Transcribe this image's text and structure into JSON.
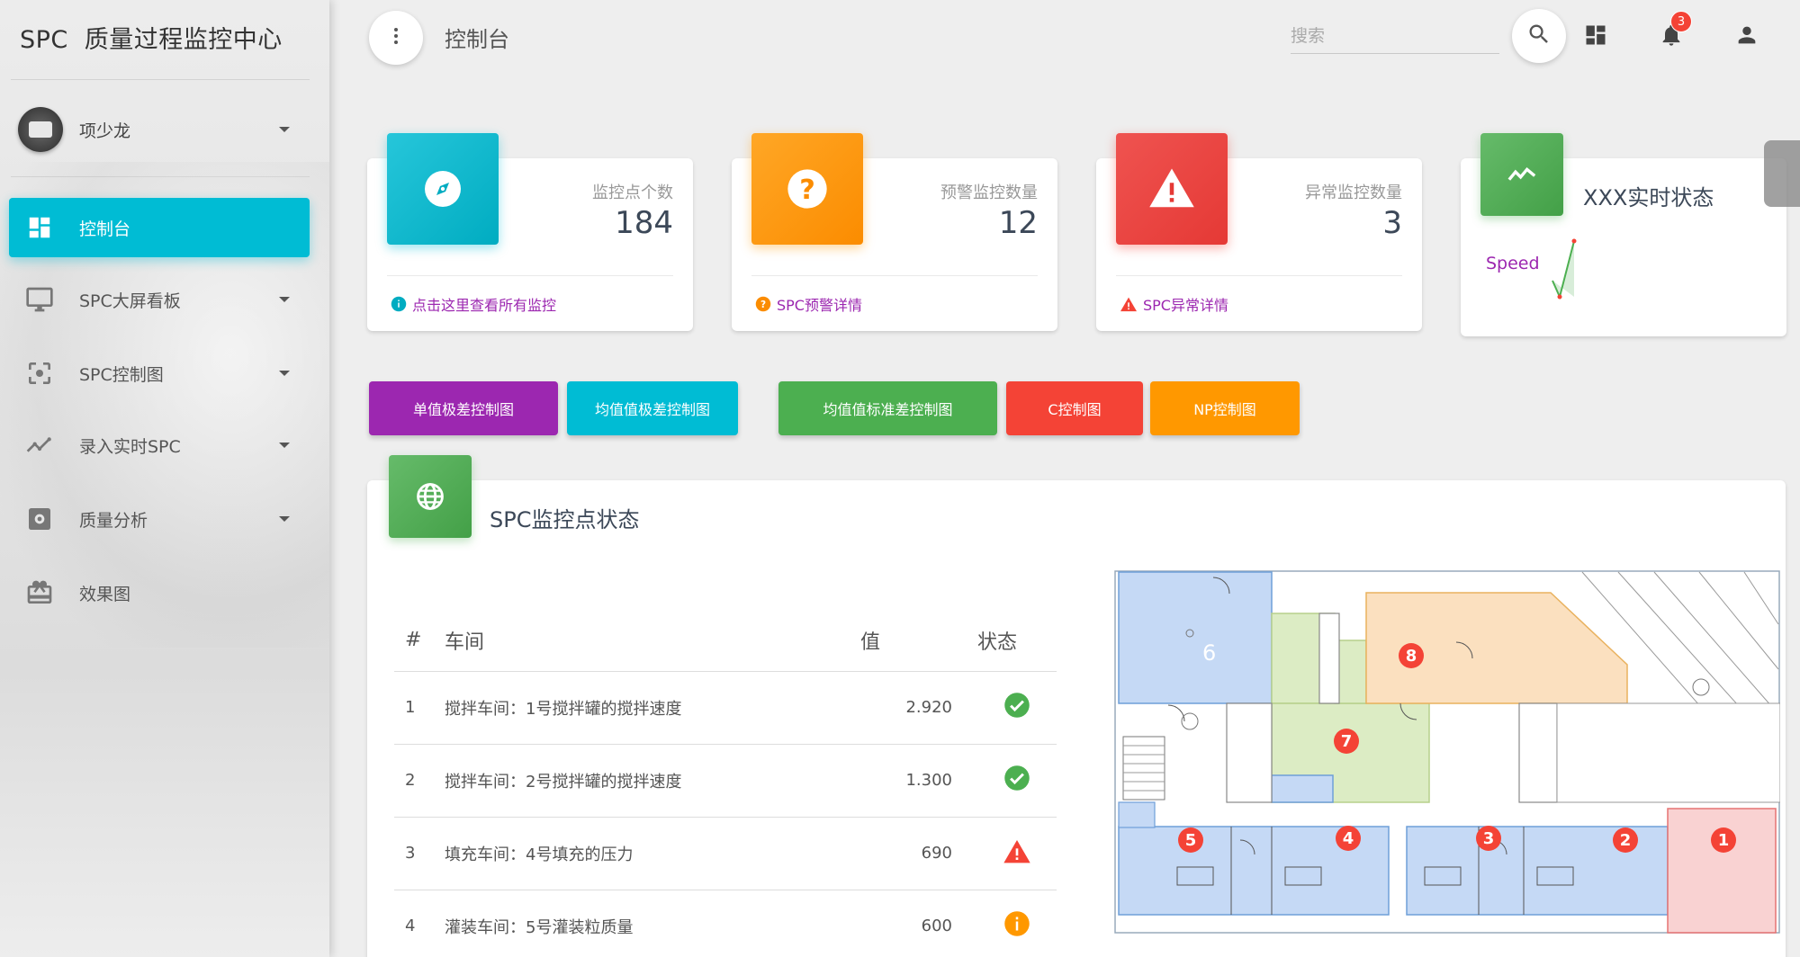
{
  "sidebar": {
    "brand_prefix": "SPC",
    "brand_title": "质量过程监控中心",
    "user_name": "项少龙",
    "items": [
      {
        "label": "控制台",
        "icon": "dashboard-icon",
        "active": true
      },
      {
        "label": "SPC大屏看板",
        "icon": "monitor-icon",
        "has_submenu": true
      },
      {
        "label": "SPC控制图",
        "icon": "center-focus-icon",
        "has_submenu": true
      },
      {
        "label": "录入实时SPC",
        "icon": "timeline-icon",
        "has_submenu": true
      },
      {
        "label": "质量分析",
        "icon": "settings-box-icon",
        "has_submenu": true
      },
      {
        "label": "效果图",
        "icon": "card-giftcard-icon"
      }
    ]
  },
  "header": {
    "title": "控制台",
    "search_placeholder": "搜索",
    "notification_count": "3",
    "icons": [
      "more-vert-icon",
      "search-icon",
      "dashboard-icon",
      "notifications-icon",
      "person-icon"
    ]
  },
  "stats": [
    {
      "category": "监控点个数",
      "value": "184",
      "link": "点击这里查看所有监控",
      "color": "#00bcd4",
      "icon": "compass-icon",
      "link_color": "#9c27b0"
    },
    {
      "category": "预警监控数量",
      "value": "12",
      "link": "SPC预警详情",
      "color": "#ff9800",
      "icon": "help-icon",
      "link_color": "#9c27b0"
    },
    {
      "category": "异常监控数量",
      "value": "3",
      "link": "SPC异常详情",
      "color": "#f44336",
      "icon": "warning-icon",
      "link_color": "#9c27b0"
    }
  ],
  "realtime": {
    "title": "XXX实时状态",
    "label": "Speed",
    "color": "#4caf50",
    "icon": "trending-icon"
  },
  "chart_buttons": [
    {
      "label": "单值极差控制图",
      "color": "#9c27b0"
    },
    {
      "label": "均值值极差控制图",
      "color": "#00bcd4"
    },
    {
      "label": "均值值标准差控制图",
      "color": "#4caf50"
    },
    {
      "label": "C控制图",
      "color": "#f44336"
    },
    {
      "label": "NP控制图",
      "color": "#ff9800"
    }
  ],
  "panel": {
    "title": "SPC监控点状态",
    "icon": "globe-icon",
    "columns": [
      "#",
      "车间",
      "值",
      "状态"
    ],
    "rows": [
      {
        "num": "1",
        "workshop": "搅拌车间：1号搅拌罐的搅拌速度",
        "value": "2.920",
        "status": "ok"
      },
      {
        "num": "2",
        "workshop": "搅拌车间：2号搅拌罐的搅拌速度",
        "value": "1.300",
        "status": "ok"
      },
      {
        "num": "3",
        "workshop": "填充车间：4号填充的压力",
        "value": "690",
        "status": "error"
      },
      {
        "num": "4",
        "workshop": "灌装车间：5号灌装粒质量",
        "value": "600",
        "status": "warning"
      }
    ]
  },
  "floor_plan": {
    "zone_labels": [
      "1",
      "2",
      "3",
      "4",
      "5",
      "6",
      "7",
      "8"
    ],
    "colors": {
      "blue": "#c5d9f5",
      "green": "#dcecc4",
      "orange": "#fbe0bf",
      "red": "#f9d2d2",
      "marker": "#f44336"
    }
  }
}
